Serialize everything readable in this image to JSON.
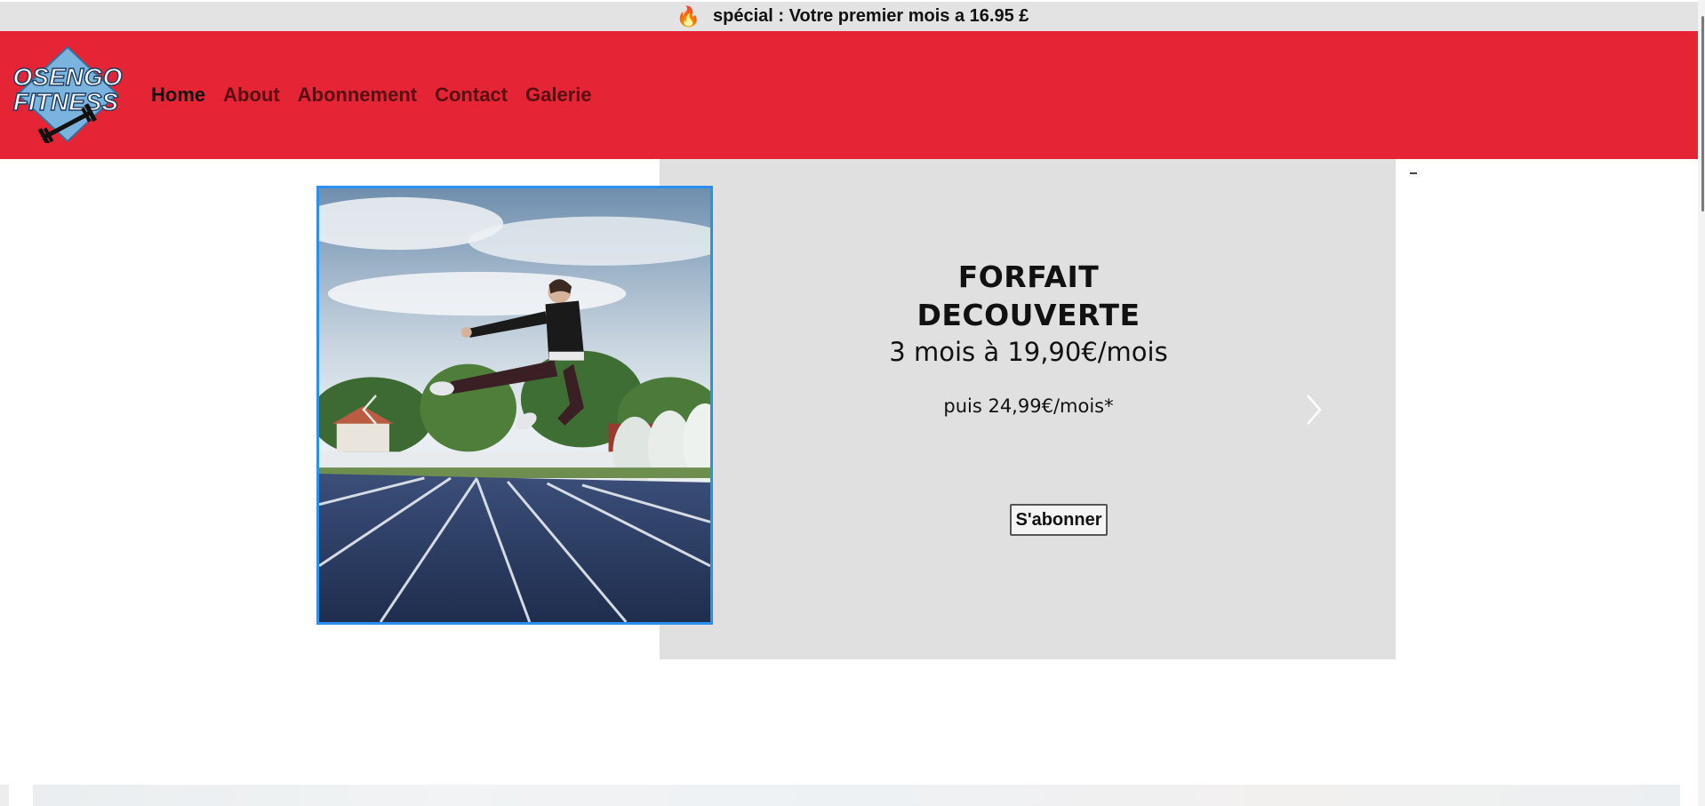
{
  "promo": {
    "icon": "fire-icon",
    "text": "spécial : Votre premier mois a 16.95 £"
  },
  "header": {
    "logo_line1": "OSENGO",
    "logo_line2": "FITNESS",
    "nav": [
      {
        "label": "Home",
        "active": true
      },
      {
        "label": "About",
        "active": false
      },
      {
        "label": "Abonnement",
        "active": false
      },
      {
        "label": "Contact",
        "active": false
      },
      {
        "label": "Galerie",
        "active": false
      }
    ],
    "colors": {
      "background": "#e52535",
      "nav_text": "#5a0d12",
      "nav_active": "#111111"
    }
  },
  "carousel": {
    "prev_icon": "chevron-left-icon",
    "next_icon": "chevron-right-icon",
    "image_subject": "athlete-jumping-on-running-track",
    "offer": {
      "title_line1": "FORFAIT",
      "title_line2": "DECOUVERTE",
      "price": "3 mois à 19,90€/mois",
      "after": "puis 24,99€/mois*",
      "cta": "S'abonner"
    },
    "colors": {
      "panel": "#e0e0e0",
      "image_border": "#2b8ff0"
    }
  },
  "misc": {
    "dash": "–"
  }
}
